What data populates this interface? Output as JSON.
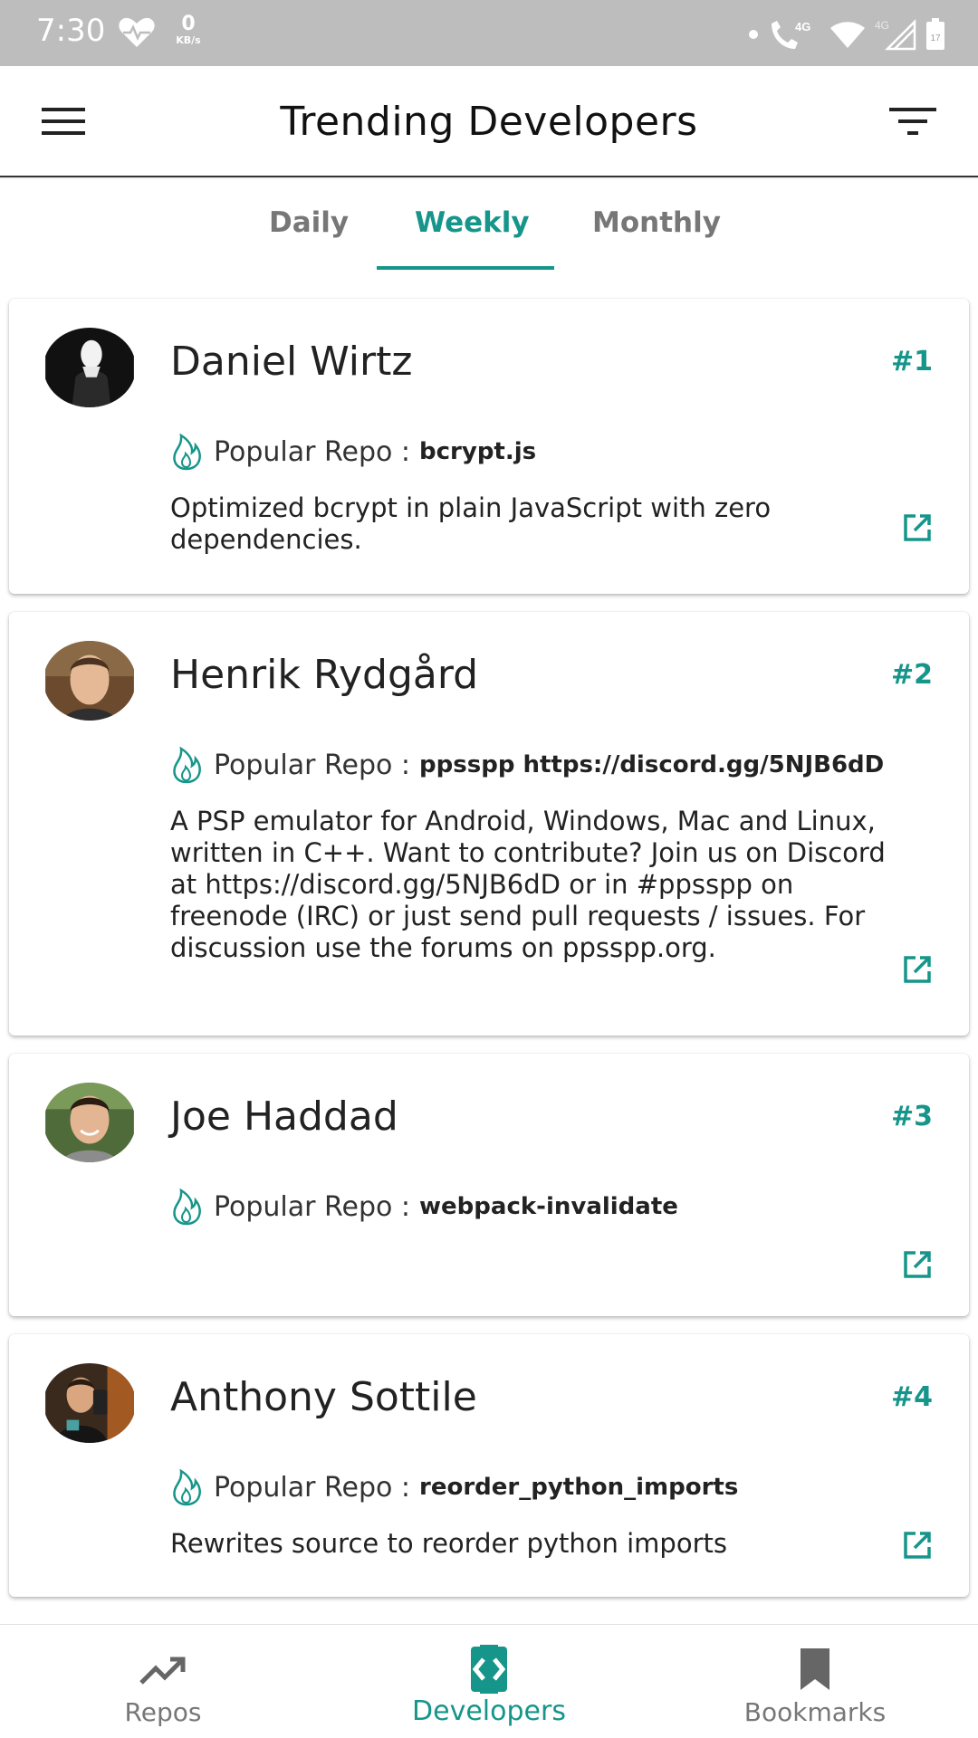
{
  "status_bar": {
    "time": "7:30",
    "speed_value": "0",
    "speed_unit": "KB/s",
    "network_label": "4G",
    "network_label_2": "4G",
    "battery_level": "17"
  },
  "app_bar": {
    "title": "Trending Developers"
  },
  "tabs": [
    {
      "label": "Daily"
    },
    {
      "label": "Weekly"
    },
    {
      "label": "Monthly"
    }
  ],
  "active_tab": "Weekly",
  "developers": [
    {
      "name": "Daniel Wirtz",
      "rank": "#1",
      "repo_label": "Popular Repo :",
      "repo_name": "bcrypt.js",
      "description": "Optimized bcrypt in plain JavaScript with zero dependencies."
    },
    {
      "name": "Henrik Rydgård",
      "rank": "#2",
      "repo_label": "Popular Repo :",
      "repo_name": "ppsspp https://discord.gg/5NJB6dD",
      "description": "A PSP emulator for Android, Windows, Mac and Linux, written in C++. Want to contribute? Join us on Discord at https://discord.gg/5NJB6dD or in #ppsspp on freenode (IRC) or just send pull requests / issues. For discussion use the forums on ppsspp.org."
    },
    {
      "name": "Joe Haddad",
      "rank": "#3",
      "repo_label": "Popular Repo :",
      "repo_name": "webpack-invalidate",
      "description": ""
    },
    {
      "name": "Anthony Sottile",
      "rank": "#4",
      "repo_label": "Popular Repo :",
      "repo_name": "reorder_python_imports",
      "description": "Rewrites source to reorder python imports"
    }
  ],
  "bottom_nav": [
    {
      "label": "Repos",
      "icon": "trending-up-icon"
    },
    {
      "label": "Developers",
      "icon": "code-brackets-icon"
    },
    {
      "label": "Bookmarks",
      "icon": "bookmark-icon"
    }
  ],
  "colors": {
    "accent": "#16958a",
    "status_bar": "#bdbdbd",
    "inactive_text": "#777777"
  }
}
